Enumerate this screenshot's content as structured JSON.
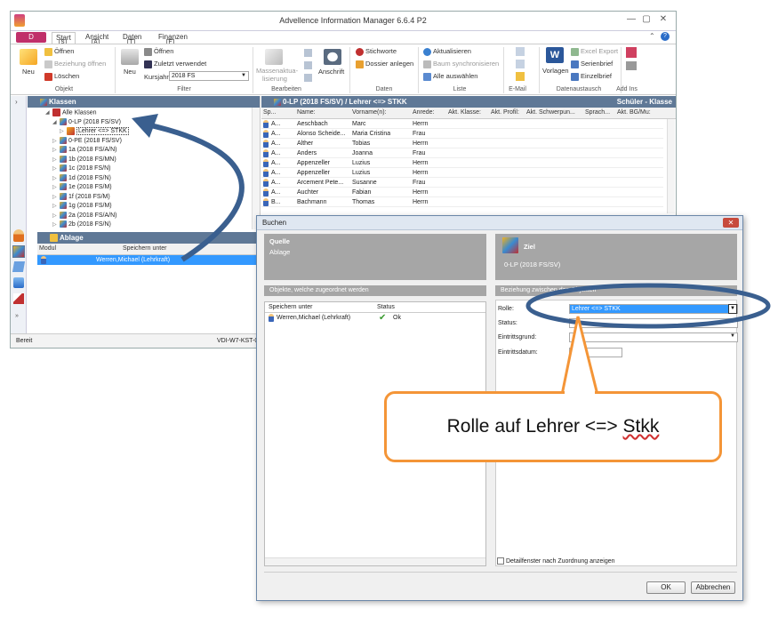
{
  "app": {
    "title": "Advellence Information Manager 6.6.4 P2",
    "file_tab": "D",
    "win_min": "—",
    "win_max": "▢",
    "win_close": "✕",
    "help": "?",
    "collapse": "⌃"
  },
  "tabs": [
    {
      "label": "Start",
      "key": "S"
    },
    {
      "label": "Ansicht",
      "key": "A"
    },
    {
      "label": "Daten",
      "key": "T"
    },
    {
      "label": "Finanzen",
      "key": "F"
    }
  ],
  "ribbon": {
    "objekt": {
      "label": "Objekt",
      "neu": "Neu",
      "oeffnen": "Öffnen",
      "beziehung": "Beziehung öffnen",
      "loeschen": "Löschen"
    },
    "filter": {
      "label": "Filter",
      "neu": "Neu",
      "oeffnen": "Öffnen",
      "zuletzt": "Zuletzt verwendet",
      "kursjahr_label": "Kursjahr",
      "kursjahr_value": "2018 FS"
    },
    "bearbeiten": {
      "label": "Bearbeiten",
      "massen": "Massenaktua-",
      "massen2": "lisierung",
      "anschrift": "Anschrift"
    },
    "daten": {
      "label": "Daten",
      "stichworte": "Stichworte",
      "dossier": "Dossier anlegen"
    },
    "liste": {
      "label": "Liste",
      "aktualisieren": "Aktualisieren",
      "baum": "Baum synchronisieren",
      "alle": "Alle auswählen"
    },
    "email": {
      "label": "E-Mail"
    },
    "datenaustausch": {
      "label": "Datenaustausch",
      "vorlagen": "Vorlagen",
      "excel": "Excel Export",
      "serienbrief": "Serienbrief",
      "einzelbrief": "Einzelbrief"
    },
    "addins": {
      "label": "Add Ins"
    }
  },
  "klassen": {
    "title": "Klassen",
    "items": [
      {
        "label": "Alle Klassen",
        "level": 0
      },
      {
        "label": "0-LP (2018 FS/SV)",
        "level": 1
      },
      {
        "label": "Lehrer <=> STKK",
        "level": 2
      },
      {
        "label": "0-PE (2018 FS/SV)",
        "level": 1
      },
      {
        "label": "1a (2018 FS/A/N)",
        "level": 1
      },
      {
        "label": "1b (2018 FS/MN)",
        "level": 1
      },
      {
        "label": "1c (2018 FS/N)",
        "level": 1
      },
      {
        "label": "1d (2018 FS/N)",
        "level": 1
      },
      {
        "label": "1e (2018 FS/M)",
        "level": 1
      },
      {
        "label": "1f (2018 FS/M)",
        "level": 1
      },
      {
        "label": "1g (2018 FS/M)",
        "level": 1
      },
      {
        "label": "2a (2018 FS/A/N)",
        "level": 1
      },
      {
        "label": "2b (2018 FS/N)",
        "level": 1
      }
    ]
  },
  "grid": {
    "title": "0-LP (2018 FS/SV) / Lehrer <=> STKK",
    "right_title": "Schüler - Klasse",
    "columns": [
      "Sp...",
      "Name:",
      "Vorname(n):",
      "Anrede:",
      "Akt. Klasse:",
      "Akt. Profil:",
      "Akt. Schwerpun...",
      "Sprach...",
      "Akt. BG/Mu:"
    ],
    "rows": [
      {
        "sp": "A...",
        "name": "Aeschbach",
        "vorname": "Marc",
        "anrede": "Herrn"
      },
      {
        "sp": "A...",
        "name": "Alonso Scheide...",
        "vorname": "Maria Cristina",
        "anrede": "Frau"
      },
      {
        "sp": "A...",
        "name": "Alther",
        "vorname": "Tobias",
        "anrede": "Herrn"
      },
      {
        "sp": "A...",
        "name": "Anders",
        "vorname": "Joanna",
        "anrede": "Frau"
      },
      {
        "sp": "A...",
        "name": "Appenzeller",
        "vorname": "Luzius",
        "anrede": "Herrn"
      },
      {
        "sp": "A...",
        "name": "Appenzeller",
        "vorname": "Luzius",
        "anrede": "Herrn"
      },
      {
        "sp": "A...",
        "name": "Arcement Pete...",
        "vorname": "Susanne",
        "anrede": "Frau"
      },
      {
        "sp": "A...",
        "name": "Auchter",
        "vorname": "Fabian",
        "anrede": "Herrn"
      },
      {
        "sp": "B...",
        "name": "Bachmann",
        "vorname": "Thomas",
        "anrede": "Herrn"
      }
    ]
  },
  "ablage": {
    "title": "Ablage",
    "col_modul": "Modul",
    "col_speichern": "Speichern unter",
    "row": "Werren,Michael (Lehrkraft)"
  },
  "status": {
    "left": "Bereit",
    "right": "VDI-W7-KST-0"
  },
  "dialog": {
    "title": "Buchen",
    "close": "✕",
    "quelle_title": "Quelle",
    "quelle_sub": "Ablage",
    "ziel_title": "Ziel",
    "ziel_sub": "0-LP (2018 FS/SV)",
    "objects_bar": "Objekte, welche zugeordnet werden",
    "col_speichern": "Speichern unter",
    "col_status": "Status",
    "obj_row": "Werren,Michael (Lehrkraft)",
    "obj_status": "Ok",
    "beziehung_bar": "Beziehung zwischen den Objekten",
    "rolle_label": "Rolle:",
    "rolle_value": "Lehrer <=> STKK",
    "status_label": "Status:",
    "eintrittsgrund_label": "Eintrittsgrund:",
    "eintrittsdatum_label": "Eintrittsdatum:",
    "detail_checkbox": "Detailfenster nach Zuordnung anzeigen",
    "ok": "OK",
    "abbrechen": "Abbrechen"
  },
  "callout": {
    "text_prefix": "Rolle auf Lehrer <=> ",
    "text_underlined": "Stkk"
  },
  "colors": {
    "annotation_blue": "#3a5f8f",
    "callout_orange": "#f49537",
    "selection": "#3399ff",
    "header": "#5f7896"
  }
}
